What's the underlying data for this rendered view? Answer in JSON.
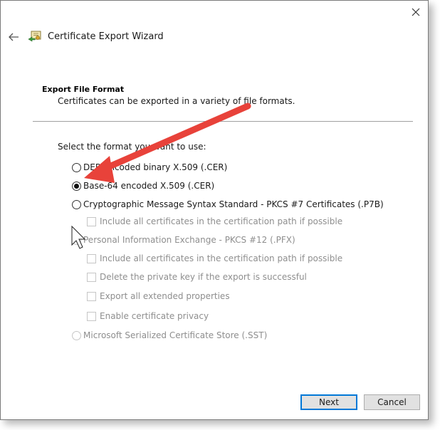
{
  "window": {
    "title": "Certificate Export Wizard"
  },
  "header": {
    "section_title": "Export File Format",
    "section_desc": "Certificates can be exported in a variety of file formats."
  },
  "form": {
    "prompt": "Select the format you want to use:",
    "der_label": "DER encoded binary X.509 (.CER)",
    "base64_label": "Base-64 encoded X.509 (.CER)",
    "pkcs7_label": "Cryptographic Message Syntax Standard - PKCS #7 Certificates (.P7B)",
    "pkcs7_include_label": "Include all certificates in the certification path if possible",
    "pfx_label": "Personal Information Exchange - PKCS #12 (.PFX)",
    "pfx_include_label": "Include all certificates in the certification path if possible",
    "pfx_delete_key_label": "Delete the private key if the export is successful",
    "pfx_export_props_label": "Export all extended properties",
    "pfx_privacy_label": "Enable certificate privacy",
    "sst_label": "Microsoft Serialized Certificate Store (.SST)",
    "selected": "base64"
  },
  "footer": {
    "next_label": "Next",
    "cancel_label": "Cancel"
  },
  "icons": {
    "close": "close-icon",
    "back": "back-arrow-icon",
    "wizard": "certificate-icon",
    "cursor": "mouse-pointer-icon",
    "annotation": "red-arrow-icon"
  },
  "colors": {
    "annotation_arrow": "#e8423a",
    "default_button_border": "#0078d7",
    "disabled_text": "#8e8e8e"
  }
}
